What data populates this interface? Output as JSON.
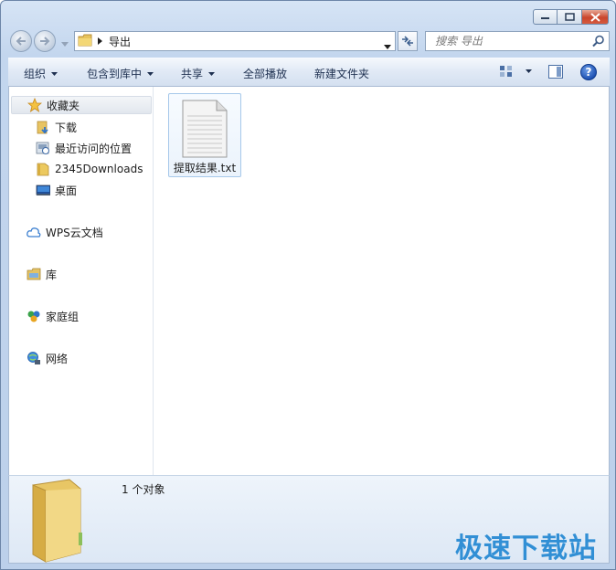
{
  "window": {
    "caption_buttons": [
      "minimize",
      "maximize",
      "close"
    ]
  },
  "nav": {
    "current_folder": "导出",
    "search_placeholder": "搜索 导出"
  },
  "toolbar": {
    "organize": "组织",
    "include_in_library": "包含到库中",
    "share": "共享",
    "play_all": "全部播放",
    "new_folder": "新建文件夹",
    "help_label": "?"
  },
  "sidebar": {
    "favorites": "收藏夹",
    "favorites_items": [
      {
        "label": "下载",
        "icon": "download-folder-icon"
      },
      {
        "label": "最近访问的位置",
        "icon": "recent-places-icon"
      },
      {
        "label": "2345Downloads",
        "icon": "folder-icon"
      },
      {
        "label": "桌面",
        "icon": "desktop-icon"
      }
    ],
    "wps_cloud": "WPS云文档",
    "libraries": "库",
    "homegroup": "家庭组",
    "network": "网络"
  },
  "files": [
    {
      "name": "提取结果.txt",
      "icon": "text-document-icon"
    }
  ],
  "details": {
    "count_text": "1 个对象"
  },
  "watermark": {
    "text": "极速下载站"
  },
  "colors": {
    "frame": "#c3d6ee",
    "selection_border": "#a6c8ea",
    "watermark": "#1f86d2"
  }
}
